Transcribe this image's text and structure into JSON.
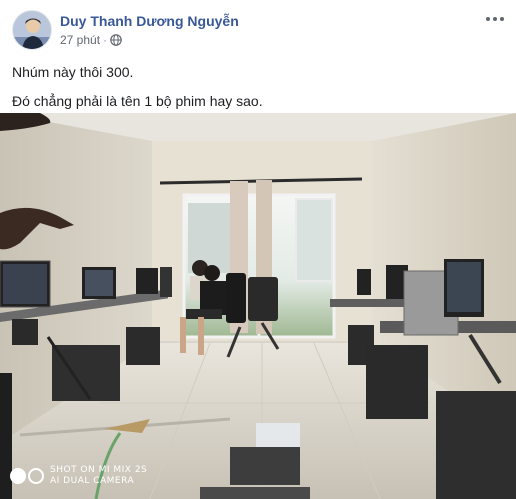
{
  "post": {
    "author": "Duy Thanh Dương Nguyễn",
    "time": "27 phút",
    "privacy_icon": "globe-icon",
    "menu_icon": "more-options-icon",
    "lines": [
      "Nhúm này thôi 300.",
      "Đó chẳng phải là tên 1 bộ phim hay sao."
    ]
  },
  "photo": {
    "watermark_line1": "SHOT ON MI MIX 2S",
    "watermark_line2": "AI DUAL CAMERA"
  },
  "colors": {
    "author_link": "#385898",
    "meta_text": "#616770",
    "body_text": "#1c1e21"
  }
}
